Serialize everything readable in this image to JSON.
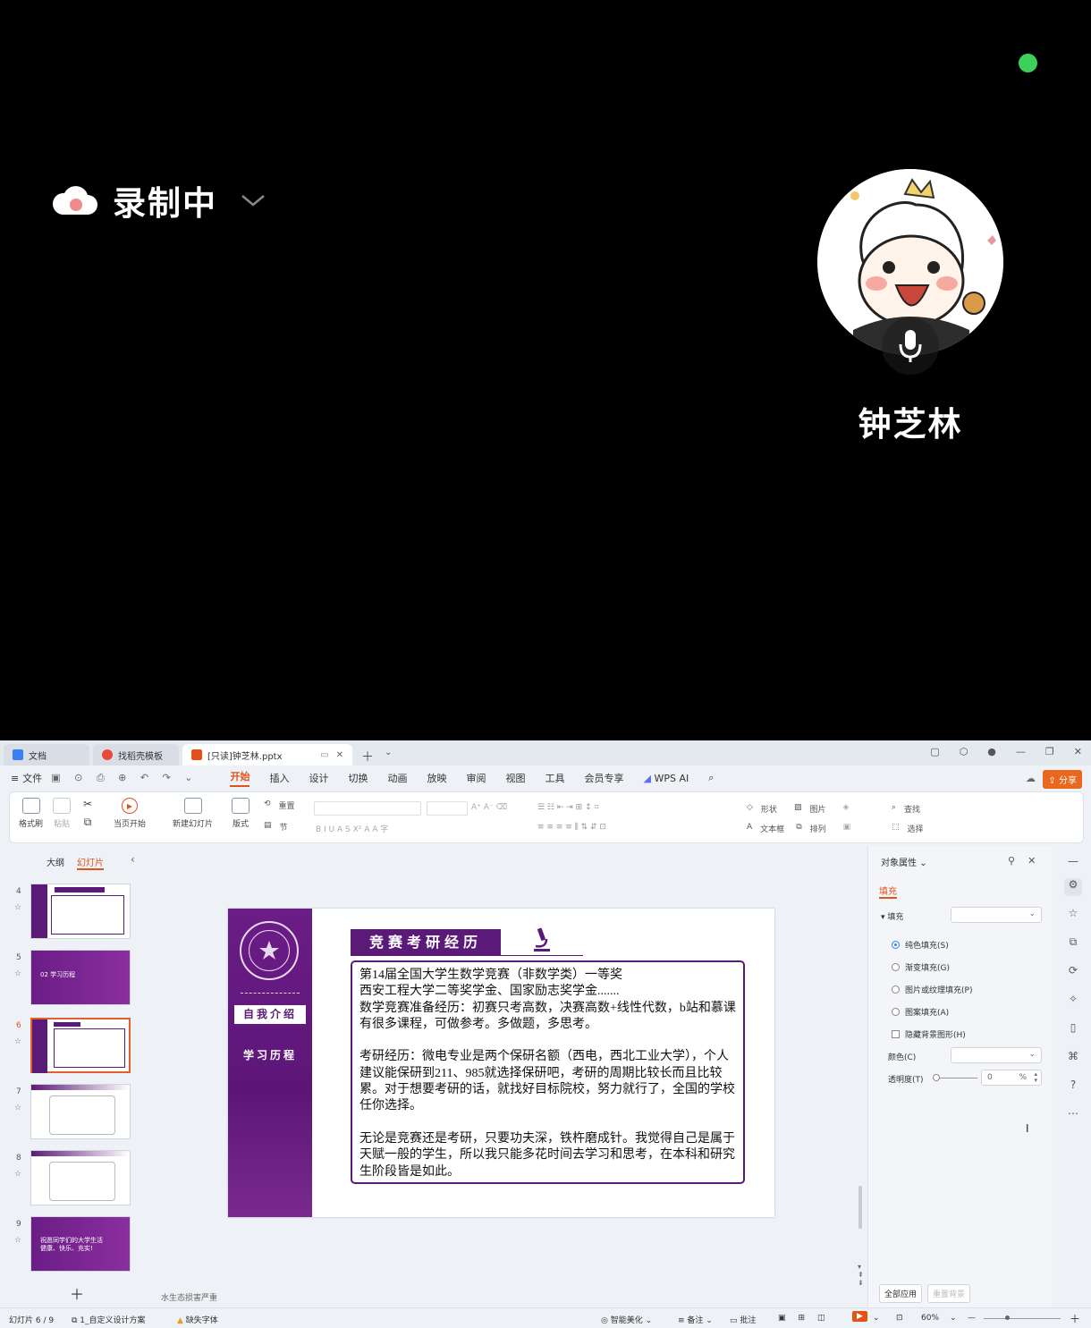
{
  "recording": {
    "label": "录制中"
  },
  "caller": {
    "name": "钟芝林"
  },
  "wps": {
    "tabs": [
      {
        "label": "文档",
        "color": "#3b7ff3"
      },
      {
        "label": "找稻壳模板",
        "color": "#e84a3a"
      },
      {
        "label": "[只读]钟芝林.pptx",
        "color": "#e0541a"
      }
    ],
    "menu": {
      "file": "文件",
      "items": [
        "开始",
        "插入",
        "设计",
        "切换",
        "动画",
        "放映",
        "审阅",
        "视图",
        "工具",
        "会员专享"
      ],
      "wps_ai": "WPS AI",
      "share": "分享"
    },
    "ribbon": {
      "format_painter": "格式刷",
      "paste": "粘贴",
      "play_from_current": "当页开始",
      "new_slide": "新建幻灯片",
      "layout": "版式",
      "reset": "重置",
      "section": "节",
      "shape": "形状",
      "picture": "图片",
      "find": "查找",
      "textbox": "文本框",
      "arrange": "排列",
      "select": "选择"
    },
    "thumbs": {
      "tab_outline": "大纲",
      "tab_slides": "幻灯片",
      "numbers": [
        "4",
        "5",
        "6",
        "7",
        "8",
        "9"
      ],
      "slide5_text": "02 学习历程",
      "slide9_text": "祝愿同学们的大学生活\n健康、快乐、充实!"
    },
    "slide": {
      "side_button": "自我介绍",
      "side_text": "学习历程",
      "title": "竞赛考研经历",
      "body": "第14届全国大学生数学竞赛（非数学类）一等奖\n西安工程大学二等奖学金、国家励志奖学金.......\n数学竞赛准备经历：初赛只考高数，决赛高数+线性代数，b站和慕课有很多课程，可做参考。多做题，多思考。\n\n考研经历：微电专业是两个保研名额（西电，西北工业大学），个人建议能保研到211、985就选择保研吧，考研的周期比较长而且比较累。对于想要考研的话，就找好目标院校，努力就行了，全国的学校任你选择。\n\n无论是竞赛还是考研，只要功夫深，铁杵磨成针。我觉得自己是属于天赋一般的学生，所以我只能多花时间去学习和思考，在本科和研究生阶段皆是如此。"
    },
    "notes_hint": "水生态损害严重",
    "props": {
      "title": "对象属性",
      "tab_fill": "填充",
      "section_fill": "填充",
      "opt_solid": "纯色填充(S)",
      "opt_gradient": "渐变填充(G)",
      "opt_picture": "图片或纹理填充(P)",
      "opt_pattern": "图案填充(A)",
      "opt_hide_bg": "隐藏背景图形(H)",
      "color_label": "颜色(C)",
      "transparency_label": "透明度(T)",
      "transparency_value": "0",
      "transparency_unit": "%",
      "apply_all": "全部应用",
      "reset_bg": "重置背景"
    },
    "status": {
      "slide_index": "幻灯片 6 / 9",
      "design": "1_自定义设计方案",
      "missing_font": "缺失字体",
      "smart_beautify": "智能美化",
      "notes": "备注",
      "comments": "批注",
      "zoom": "60%"
    }
  }
}
